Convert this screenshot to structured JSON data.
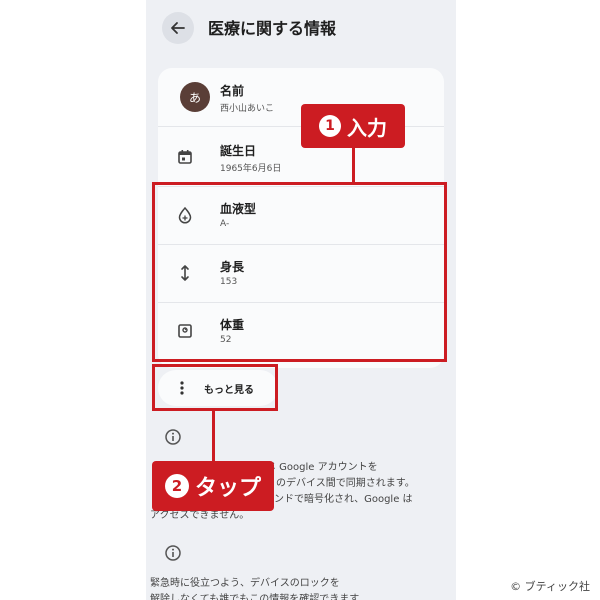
{
  "screen": {
    "title": "医療に関する情報"
  },
  "rows": [
    {
      "label": "名前",
      "value": "西小山あいこ",
      "avatar": "あ"
    },
    {
      "label": "誕生日",
      "value": "1965年6月6日",
      "icon": "calendar-icon"
    },
    {
      "label": "血液型",
      "value": "A-",
      "icon": "blood-drop-icon"
    },
    {
      "label": "身長",
      "value": "153",
      "icon": "height-arrows-icon"
    },
    {
      "label": "体重",
      "value": "52",
      "icon": "weight-scale-icon"
    }
  ],
  "more_button": {
    "label": "もっと見る"
  },
  "info_blocks": [
    {
      "icon": "info-icon",
      "lines": [
        "じ Google アカウントを",
        "のデバイス間で同期されます。",
        "ンドで暗号化され、Google は",
        "アクセスできません。"
      ]
    },
    {
      "icon": "info-icon",
      "lines": [
        "緊急時に役立つよう、デバイスのロックを",
        "解除しなくても誰でもこの情報を確認できます"
      ]
    }
  ],
  "annotations": [
    {
      "number": "1",
      "text": "入力"
    },
    {
      "number": "2",
      "text": "タップ"
    }
  ],
  "credit": "© ブティック社",
  "colors": {
    "accent_red": "#cc1c22",
    "screen_bg": "#eef0f4",
    "card_bg": "#fafbfc"
  }
}
